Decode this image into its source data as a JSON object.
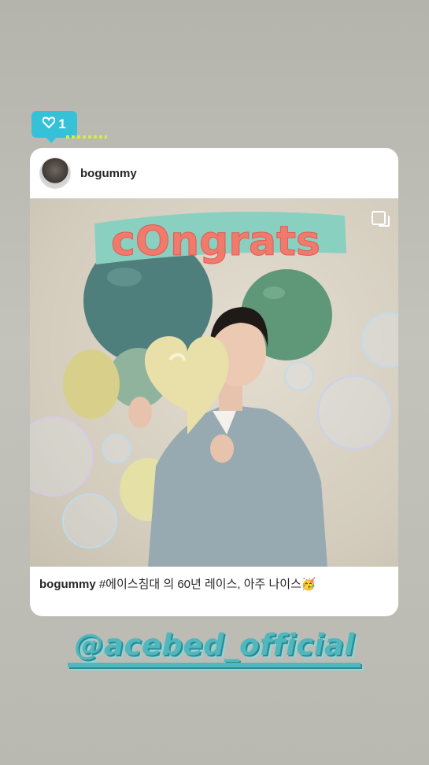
{
  "like_sticker": {
    "count": "1",
    "icon": "heart-outline-icon",
    "color": "#35c2d9"
  },
  "post": {
    "username": "bogummy",
    "photo": {
      "sign_text": "cOngrats",
      "colors": {
        "teal_balloon": "#4f7f7c",
        "green_balloon": "#5f9878",
        "gold_balloon": "#e3dc9e",
        "sign": "#f07a6c"
      },
      "multi_image_icon": "carousel-icon"
    },
    "caption": {
      "username": "bogummy",
      "text": "#에이스침대 의 60년 레이스, 아주 나이스🥳"
    }
  },
  "mention_sticker": {
    "text": "@acebed_official",
    "color": "#4fb7bd"
  }
}
